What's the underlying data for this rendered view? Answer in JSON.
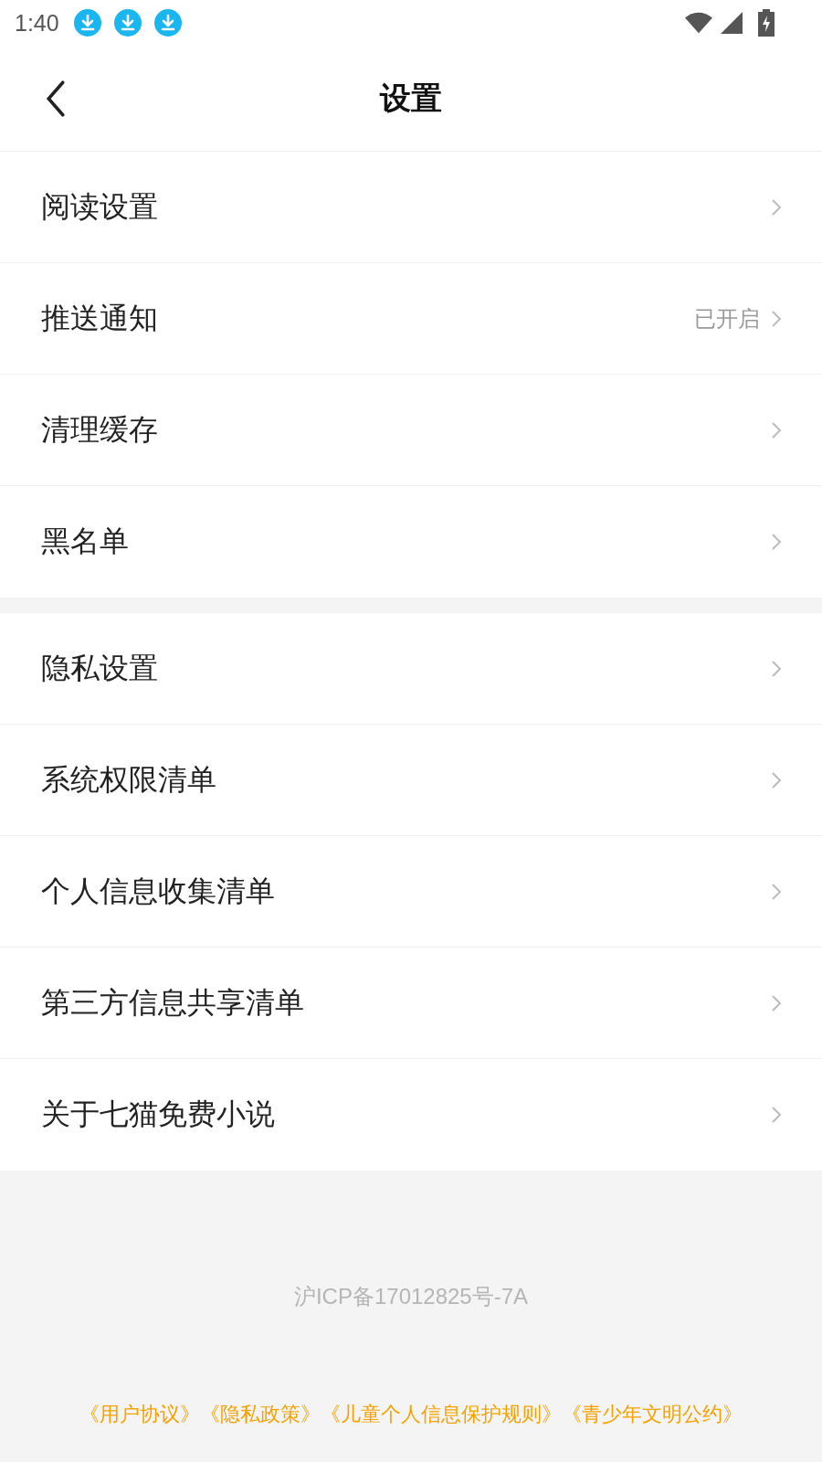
{
  "status_bar": {
    "time": "1:40"
  },
  "header": {
    "title": "设置"
  },
  "sections": [
    [
      {
        "label": "阅读设置"
      },
      {
        "label": "推送通知",
        "value": "已开启"
      },
      {
        "label": "清理缓存"
      },
      {
        "label": "黑名单"
      }
    ],
    [
      {
        "label": "隐私设置"
      },
      {
        "label": "系统权限清单"
      },
      {
        "label": "个人信息收集清单"
      },
      {
        "label": "第三方信息共享清单"
      },
      {
        "label": "关于七猫免费小说"
      }
    ]
  ],
  "footer": {
    "icp": "沪ICP备17012825号-7A",
    "links": [
      "《用户协议》",
      "《隐私政策》",
      "《儿童个人信息保护规则》",
      "《青少年文明公约》"
    ]
  }
}
